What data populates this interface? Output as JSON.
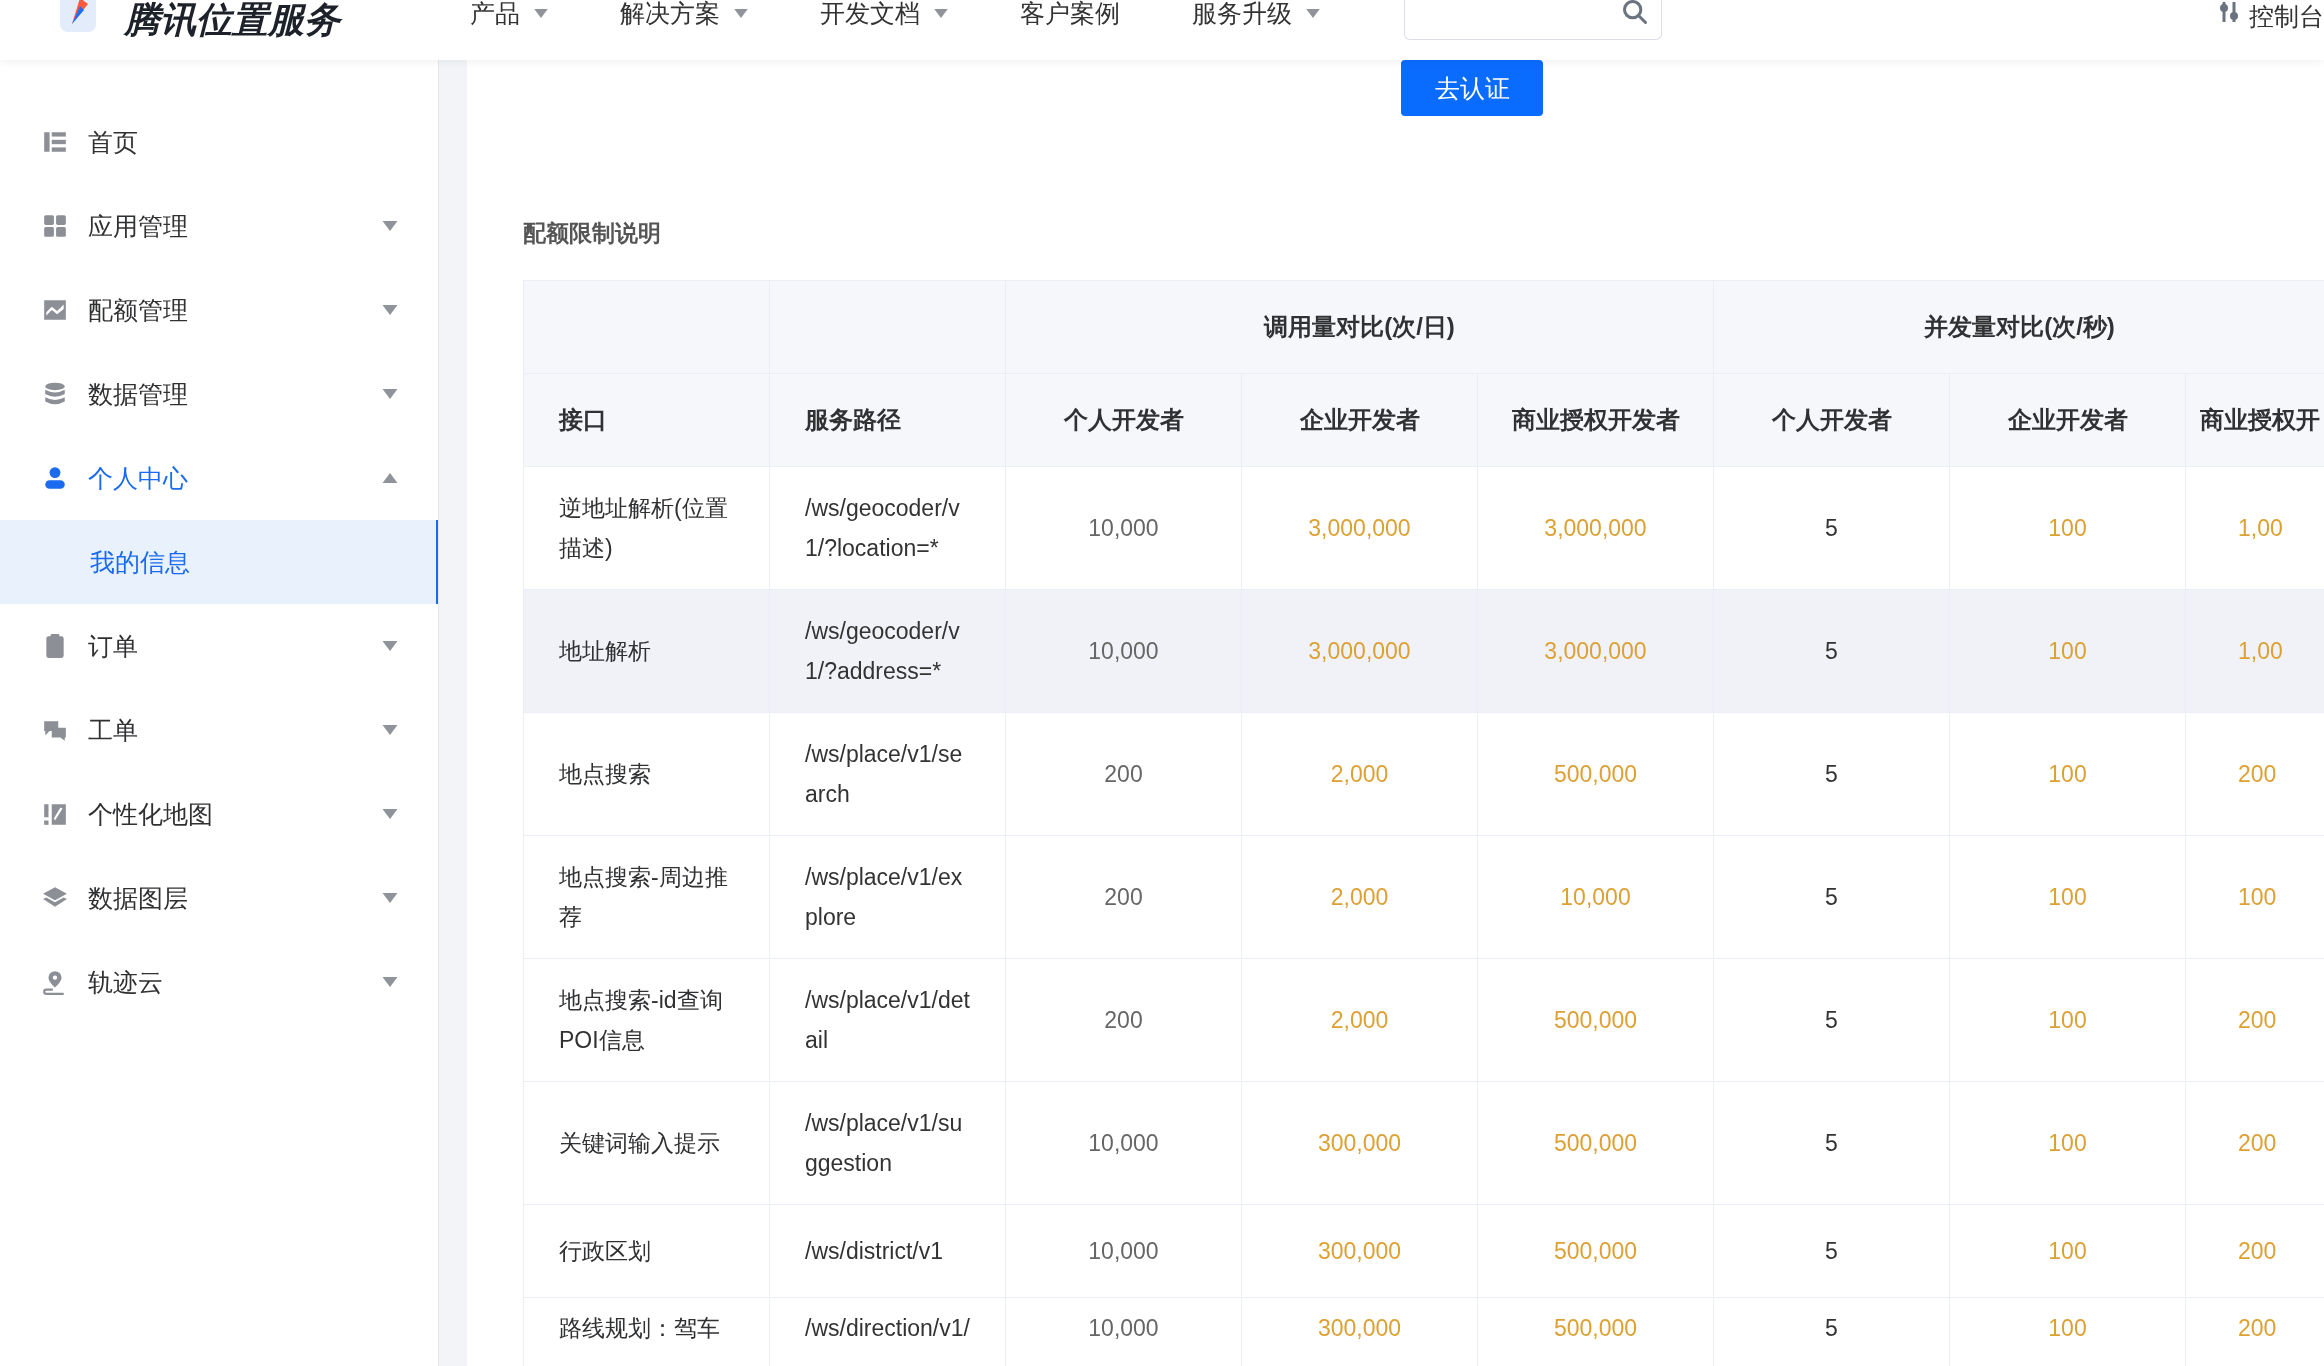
{
  "header": {
    "brand": "腾讯位置服务",
    "nav": [
      {
        "label": "产品",
        "dropdown": true
      },
      {
        "label": "解决方案",
        "dropdown": true
      },
      {
        "label": "开发文档",
        "dropdown": true
      },
      {
        "label": "客户案例",
        "dropdown": false
      },
      {
        "label": "服务升级",
        "dropdown": true
      }
    ],
    "console": "控制台"
  },
  "sidebar": {
    "items": [
      {
        "label": "首页",
        "active": false
      },
      {
        "label": "应用管理",
        "active": false,
        "expanded": false
      },
      {
        "label": "配额管理",
        "active": false,
        "expanded": false
      },
      {
        "label": "数据管理",
        "active": false,
        "expanded": false
      },
      {
        "label": "个人中心",
        "active": true,
        "expanded": true,
        "children": [
          {
            "label": "我的信息",
            "selected": true
          }
        ]
      },
      {
        "label": "订单",
        "active": false,
        "expanded": false
      },
      {
        "label": "工单",
        "active": false,
        "expanded": false
      },
      {
        "label": "个性化地图",
        "active": false,
        "expanded": false
      },
      {
        "label": "数据图层",
        "active": false,
        "expanded": false
      },
      {
        "label": "轨迹云",
        "active": false,
        "expanded": false
      }
    ]
  },
  "verify_button": "去认证",
  "section_title": "配额限制说明",
  "table": {
    "groups": [
      {
        "label": "调用量对比(次/日)"
      },
      {
        "label": "并发量对比(次/秒)"
      }
    ],
    "columns": [
      "接口",
      "服务路径",
      "个人开发者",
      "企业开发者",
      "商业授权开发者",
      "个人开发者",
      "企业开发者",
      "商业授权开"
    ],
    "rows": [
      {
        "highlighted": false,
        "cells": [
          "逆地址解析(位置描述)",
          "/ws/geocoder/v1/?location=*",
          "10,000",
          "3,000,000",
          "3,000,000",
          "5",
          "100",
          "1,00"
        ]
      },
      {
        "highlighted": true,
        "cells": [
          "地址解析",
          "/ws/geocoder/v1/?address=*",
          "10,000",
          "3,000,000",
          "3,000,000",
          "5",
          "100",
          "1,00"
        ]
      },
      {
        "highlighted": false,
        "cells": [
          "地点搜索",
          "/ws/place/v1/search",
          "200",
          "2,000",
          "500,000",
          "5",
          "100",
          "200"
        ]
      },
      {
        "highlighted": false,
        "cells": [
          "地点搜索-周边推荐",
          "/ws/place/v1/explore",
          "200",
          "2,000",
          "10,000",
          "5",
          "100",
          "100"
        ]
      },
      {
        "highlighted": false,
        "cells": [
          "地点搜索-id查询POI信息",
          "/ws/place/v1/detail",
          "200",
          "2,000",
          "500,000",
          "5",
          "100",
          "200"
        ]
      },
      {
        "highlighted": false,
        "cells": [
          "关键词输入提示",
          "/ws/place/v1/suggestion",
          "10,000",
          "300,000",
          "500,000",
          "5",
          "100",
          "200"
        ]
      },
      {
        "highlighted": false,
        "cells": [
          "行政区划",
          "/ws/district/v1",
          "10,000",
          "300,000",
          "500,000",
          "5",
          "100",
          "200"
        ]
      },
      {
        "highlighted": false,
        "cells": [
          "路线规划：驾车",
          "/ws/direction/v1/",
          "10,000",
          "300,000",
          "500,000",
          "5",
          "100",
          "200"
        ]
      }
    ]
  }
}
